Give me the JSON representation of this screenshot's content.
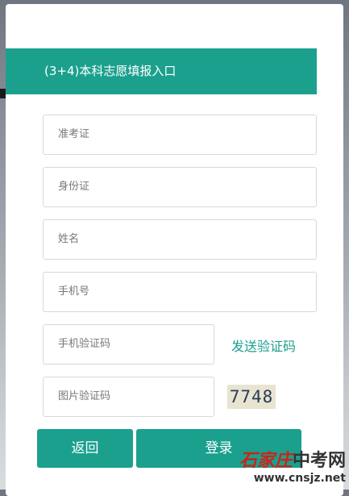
{
  "header": {
    "title": "(3+4)本科志愿填报入口"
  },
  "form": {
    "exam_id_placeholder": "准考证",
    "id_card_placeholder": "身份证",
    "name_placeholder": "姓名",
    "phone_placeholder": "手机号",
    "sms_code_placeholder": "手机验证码",
    "image_code_placeholder": "图片验证码",
    "send_code_label": "发送验证码",
    "captcha_text": "7748"
  },
  "actions": {
    "back_label": "返回",
    "login_label": "登录"
  },
  "watermark": {
    "script_text": "石家庄",
    "name_text": "中考网",
    "url": "www.cnsjz.net"
  },
  "colors": {
    "accent": "#1ba08e",
    "watermark_red": "#c8251b"
  }
}
